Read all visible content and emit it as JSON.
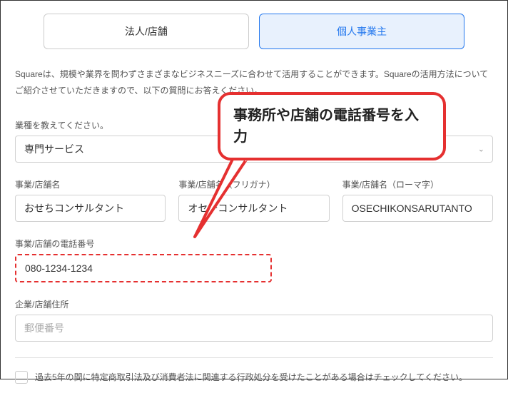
{
  "tabs": {
    "corporate": "法人/店舗",
    "individual": "個人事業主"
  },
  "intro": "Squareは、規模や業界を問わずさまざまなビジネスニーズに合わせて活用することができます。Squareの活用方法についてご紹介させていただきますので、以下の質問にお答えください。",
  "industry": {
    "label": "業種を教えてください。",
    "value": "専門サービス"
  },
  "businessName": {
    "label": "事業/店舗名",
    "value": "おせちコンサルタント"
  },
  "businessNameKana": {
    "label": "事業/店舗名（フリガナ）",
    "value": "オセチコンサルタント"
  },
  "businessNameRomaji": {
    "label": "事業/店舗名（ローマ字）",
    "value": "OSECHIKONSARUTANTO"
  },
  "phone": {
    "label": "事業/店舗の電話番号",
    "value": "080-1234-1234"
  },
  "address": {
    "label": "企業/店舗住所",
    "placeholder": "郵便番号"
  },
  "checkbox": {
    "label": "過去5年の間に特定商取引法及び消費者法に関連する行政処分を受けたことがある場合はチェックしてください。"
  },
  "callout": "事務所や店舗の電話番号を入力"
}
